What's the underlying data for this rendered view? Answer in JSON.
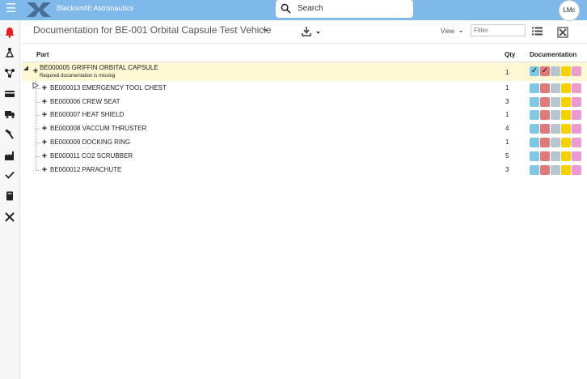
{
  "app": {
    "brand": "Blacksmith Astronautics",
    "avatar": "LMc",
    "search_placeholder": "Search"
  },
  "header": {
    "title": "Documentation for BE-001 Orbital Capsule Test Vehicle",
    "view_label": "View",
    "filter_placeholder": "Filter"
  },
  "columns": {
    "part": "Part",
    "qty": "Qty",
    "documentation": "Documentation"
  },
  "colors": {
    "topbar": "#7fb8ea",
    "root_highlight": "#fbf8d3",
    "doc_blue": "#7ec8e3",
    "doc_red": "#e07a7a",
    "doc_gray": "#b8c4d0",
    "doc_yellow": "#f5d000",
    "doc_pink": "#ec9ad0",
    "bell_red": "#e02020"
  },
  "root": {
    "name": "BE000005 GRIFFIN ORBITAL CAPSULE",
    "sub": "Required documentation is missing",
    "qty": "1",
    "checks": [
      true,
      true,
      false,
      false,
      false
    ]
  },
  "rows": [
    {
      "name": "BE000013 EMERGENCY TOOL CHEST",
      "qty": "1"
    },
    {
      "name": "BE000006 CREW SEAT",
      "qty": "3"
    },
    {
      "name": "BE000007 HEAT SHIELD",
      "qty": "1"
    },
    {
      "name": "BE000008 VACCUM THRUSTER",
      "qty": "4"
    },
    {
      "name": "BE000009 DOCKING RING",
      "qty": "1"
    },
    {
      "name": "BE000011 CO2 SCRUBBER",
      "qty": "5"
    },
    {
      "name": "BE000012 PARACHUTE",
      "qty": "3"
    }
  ],
  "sidebar": [
    "bell-icon",
    "people-icon",
    "network-icon",
    "card-icon",
    "truck-icon",
    "hammer-icon",
    "factory-icon",
    "check-icon",
    "book-icon",
    "tools-icon"
  ]
}
